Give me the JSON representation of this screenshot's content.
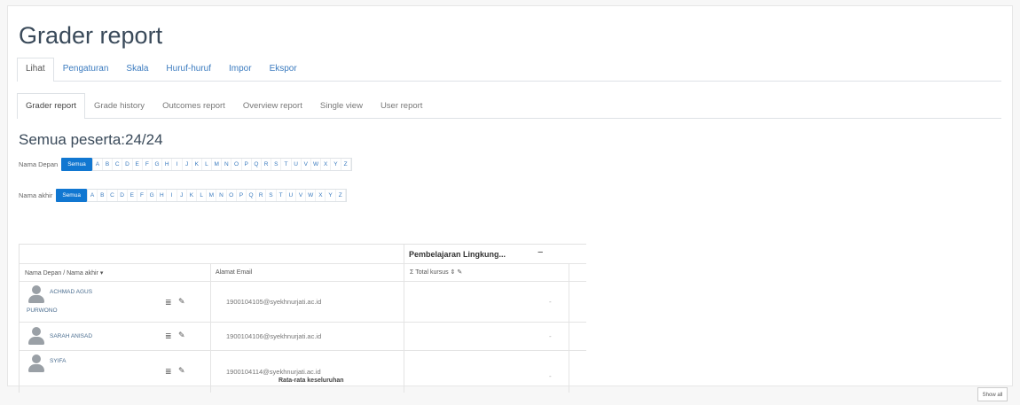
{
  "page": {
    "title": "Grader report"
  },
  "tabs_top": [
    {
      "label": "Lihat",
      "active": true
    },
    {
      "label": "Pengaturan",
      "active": false
    },
    {
      "label": "Skala",
      "active": false
    },
    {
      "label": "Huruf-huruf",
      "active": false
    },
    {
      "label": "Impor",
      "active": false
    },
    {
      "label": "Ekspor",
      "active": false
    }
  ],
  "tabs_second": [
    {
      "label": "Grader report",
      "active": true
    },
    {
      "label": "Grade history",
      "active": false
    },
    {
      "label": "Outcomes report",
      "active": false
    },
    {
      "label": "Overview report",
      "active": false
    },
    {
      "label": "Single view",
      "active": false
    },
    {
      "label": "User report",
      "active": false
    }
  ],
  "participants": {
    "heading": "Semua peserta:24/24"
  },
  "initials_first": {
    "label": "Nama Depan",
    "all_label": "Semua"
  },
  "initials_last": {
    "label": "Nama akhir",
    "all_label": "Semua"
  },
  "letters": [
    "A",
    "B",
    "C",
    "D",
    "E",
    "F",
    "G",
    "H",
    "I",
    "J",
    "K",
    "L",
    "M",
    "N",
    "O",
    "P",
    "Q",
    "R",
    "S",
    "T",
    "U",
    "V",
    "W",
    "X",
    "Y",
    "Z"
  ],
  "grid": {
    "category_header": "Pembelajaran Lingkung...",
    "category_collapse_icon": "minus-icon",
    "col_name": "Nama Depan / Nama akhir",
    "col_name_sort_icon": "caret-down-icon",
    "col_email": "Alamat Email",
    "col_total": "Total kursus",
    "rows": [
      {
        "name_line1": "ACHMAD AGUS",
        "name_line2": "PURWONO",
        "email": "1900104105@syekhnurjati.ac.id",
        "grade": "-"
      },
      {
        "name_line1": "SARAH ANISAD",
        "name_line2": "",
        "email": "1900104106@syekhnurjati.ac.id",
        "grade": "-"
      },
      {
        "name_line1": "SYIFA",
        "name_line2": "",
        "email": "1900104114@syekhnurjati.ac.id",
        "grade": "-"
      }
    ],
    "average_label": "Rata-rata keseluruhan",
    "average_value": "-"
  },
  "footer": {
    "show_all_label": "Show all"
  },
  "colors": {
    "accent": "#1177d1",
    "link": "#3b7bbf",
    "title": "#3a4a5a"
  }
}
